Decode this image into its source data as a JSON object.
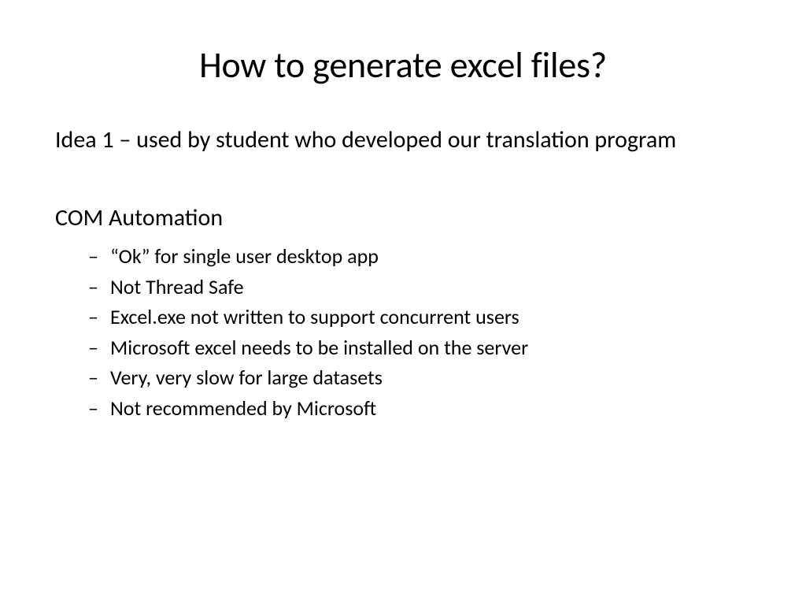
{
  "slide": {
    "title": "How to generate excel files?",
    "intro": "Idea 1 – used by student who developed our translation program",
    "section_heading": "COM Automation",
    "bullets": [
      "“Ok” for single user desktop app",
      "Not Thread Safe",
      "Excel.exe not written to support concurrent users",
      "Microsoft excel needs to be installed on the server",
      "Very, very slow for large datasets",
      "Not recommended by Microsoft"
    ]
  }
}
